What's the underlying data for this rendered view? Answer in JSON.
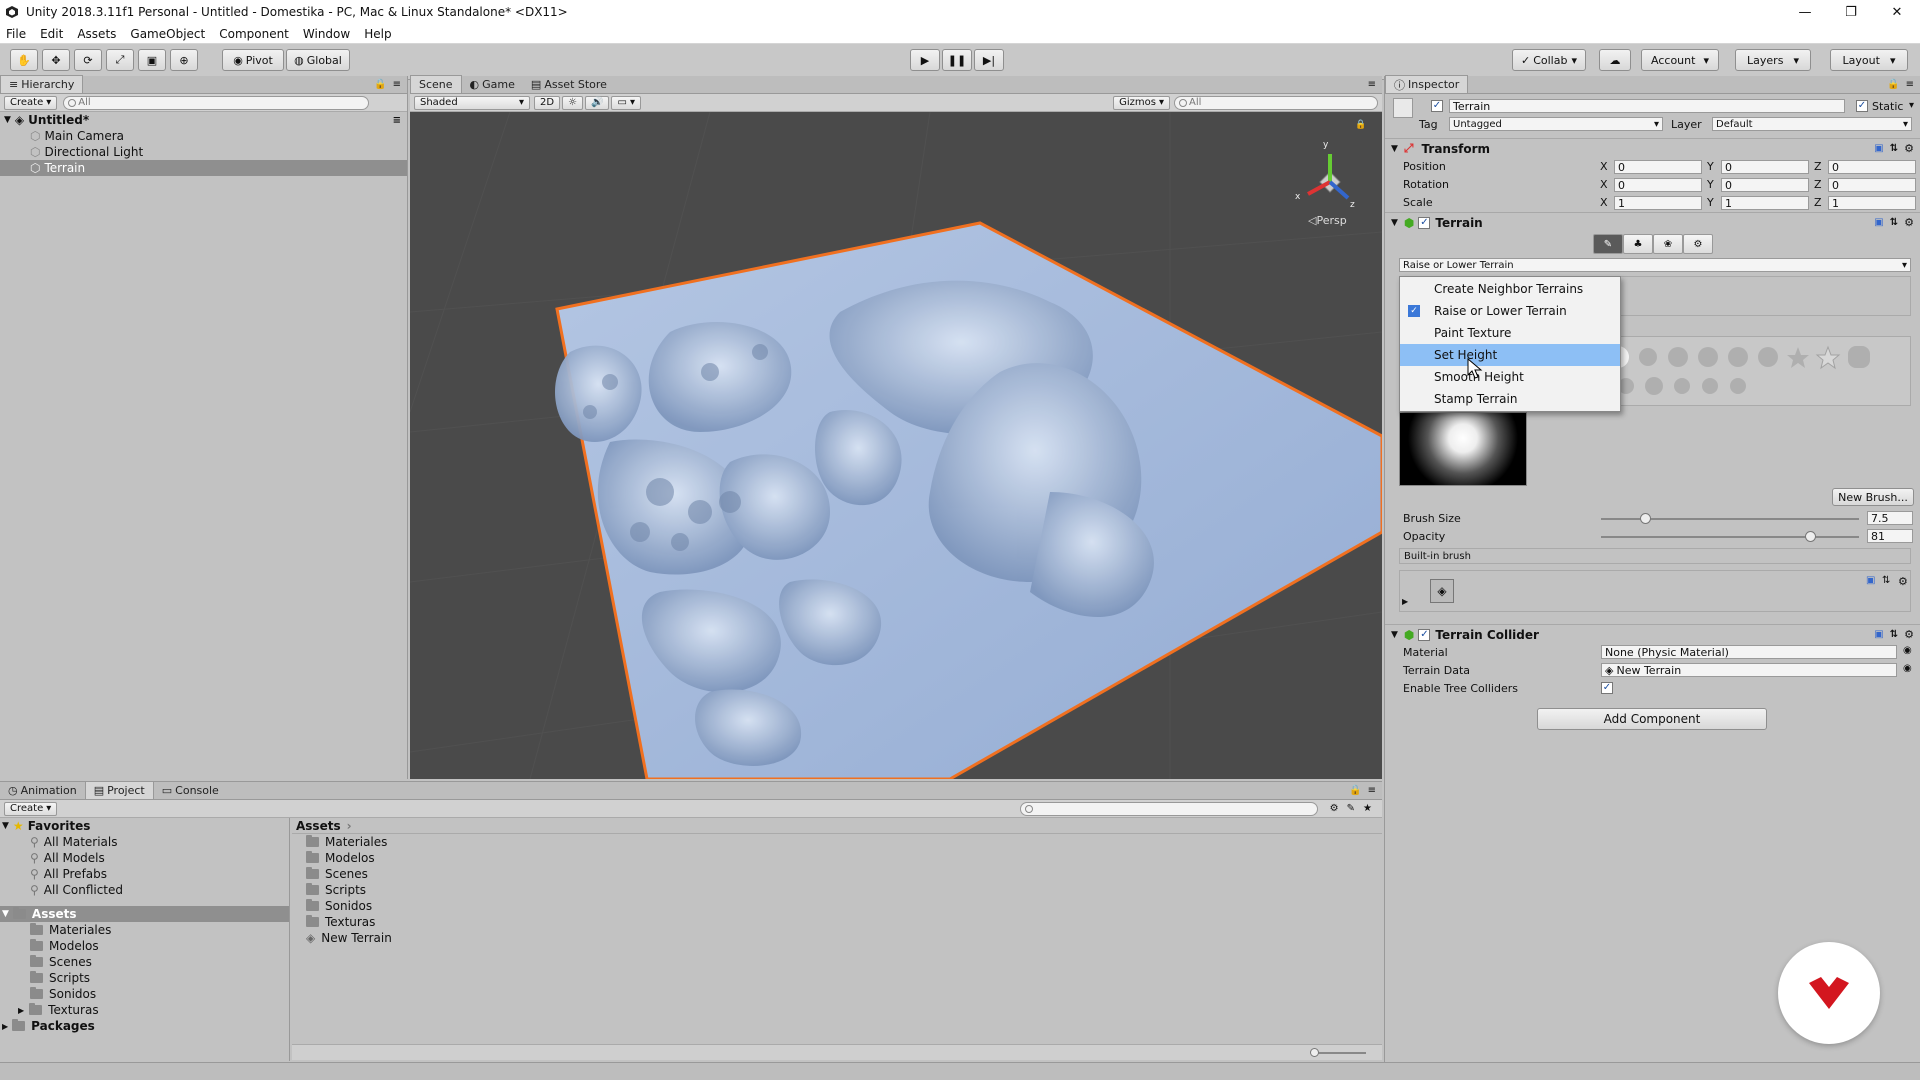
{
  "window": {
    "title": "Unity 2018.3.11f1 Personal - Untitled - Domestika - PC, Mac & Linux Standalone* <DX11>",
    "minimize": "—",
    "maximize": "❐",
    "close": "✕"
  },
  "menu": [
    "File",
    "Edit",
    "Assets",
    "GameObject",
    "Component",
    "Window",
    "Help"
  ],
  "toolbar": {
    "pivot": "Pivot",
    "global": "Global",
    "collab": "Collab",
    "account": "Account",
    "layers": "Layers",
    "layout": "Layout"
  },
  "hierarchy": {
    "tab": "Hierarchy",
    "create": "Create",
    "search_placeholder": "All",
    "scene": "Untitled*",
    "items": [
      "Main Camera",
      "Directional Light",
      "Terrain"
    ]
  },
  "scene_view": {
    "tabs": [
      "Scene",
      "Game",
      "Asset Store"
    ],
    "shading": "Shaded",
    "mode_2d": "2D",
    "gizmos": "Gizmos",
    "search_placeholder": "All",
    "persp": "Persp",
    "axis_y": "y",
    "axis_x": "x",
    "axis_z": "z"
  },
  "inspector": {
    "tab": "Inspector",
    "object_name": "Terrain",
    "static_label": "Static",
    "tag_label": "Tag",
    "tag_value": "Untagged",
    "layer_label": "Layer",
    "layer_value": "Default",
    "transform": {
      "title": "Transform",
      "rows": [
        {
          "label": "Position",
          "x": "0",
          "y": "0",
          "z": "0"
        },
        {
          "label": "Rotation",
          "x": "0",
          "y": "0",
          "z": "0"
        },
        {
          "label": "Scale",
          "x": "1",
          "y": "1",
          "z": "1"
        }
      ],
      "x": "X",
      "y": "Y",
      "z": "Z"
    },
    "terrain": {
      "title": "Terrain",
      "tool_dropdown": "Raise or Lower Terrain",
      "dropdown_items": [
        {
          "label": "Create Neighbor Terrains",
          "checked": false
        },
        {
          "label": "Raise or Lower Terrain",
          "checked": true
        },
        {
          "label": "Paint Texture",
          "checked": false
        },
        {
          "label": "Set Height",
          "checked": false
        },
        {
          "label": "Smooth Height",
          "checked": false
        },
        {
          "label": "Stamp Terrain",
          "checked": false
        }
      ],
      "selected_item": "Set Height",
      "new_brush": "New Brush...",
      "brush_size_label": "Brush Size",
      "brush_size_value": "7.5",
      "brush_size_fraction": 0.17,
      "opacity_label": "Opacity",
      "opacity_value": "81",
      "opacity_fraction": 0.81,
      "builtin_brush": "Built-in brush"
    },
    "collider": {
      "title": "Terrain Collider",
      "material_label": "Material",
      "material_value": "None (Physic Material)",
      "data_label": "Terrain Data",
      "data_value": "New Terrain",
      "trees_label": "Enable Tree Colliders"
    },
    "add_component": "Add Component"
  },
  "bottom": {
    "tabs": [
      "Animation",
      "Project",
      "Console"
    ],
    "create": "Create",
    "favorites_label": "Favorites",
    "favorites": [
      "All Materials",
      "All Models",
      "All Prefabs",
      "All Conflicted"
    ],
    "assets_label": "Assets",
    "asset_folders": [
      "Materiales",
      "Modelos",
      "Scenes",
      "Scripts",
      "Sonidos",
      "Texturas"
    ],
    "packages_label": "Packages",
    "breadcrumb": "Assets",
    "assets_list": [
      "Materiales",
      "Modelos",
      "Scenes",
      "Scripts",
      "Sonidos",
      "Texturas",
      "New Terrain"
    ]
  },
  "colors": {
    "terrain_outline": "#f07020",
    "terrain_fill": "#9fb8dc",
    "selection": "#8dbff5",
    "brand_badge": "#d3161f"
  }
}
